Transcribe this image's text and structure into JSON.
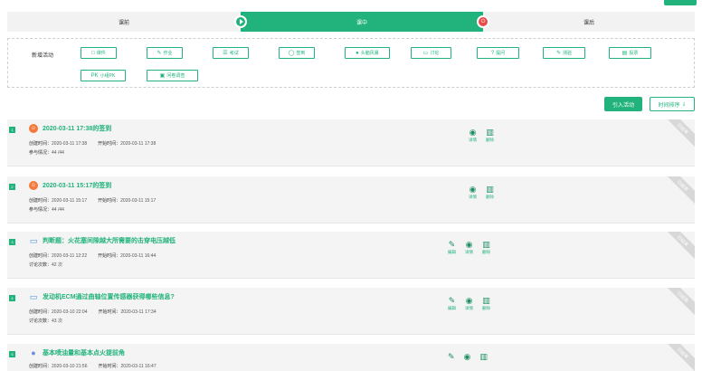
{
  "stages": {
    "before": "课前",
    "during": "课中",
    "after": "课后",
    "stop_icon": "power-icon"
  },
  "activities": {
    "title": "新增活动",
    "buttons": [
      {
        "name": "courseware",
        "label": "课件",
        "icon": "□"
      },
      {
        "name": "homework",
        "label": "作业",
        "icon": "✎"
      },
      {
        "name": "exam",
        "label": "考试",
        "icon": "☰"
      },
      {
        "name": "sign-in",
        "label": "签到",
        "icon": "◯"
      },
      {
        "name": "brainstorm",
        "label": "头脑风暴",
        "icon": "●"
      },
      {
        "name": "discussion",
        "label": "讨论",
        "icon": "▭"
      },
      {
        "name": "question",
        "label": "提问",
        "icon": "?"
      },
      {
        "name": "quiz",
        "label": "测验",
        "icon": "✎"
      },
      {
        "name": "vote",
        "label": "投票",
        "icon": "▤"
      },
      {
        "name": "pk",
        "label": "小组PK",
        "icon": "PK"
      },
      {
        "name": "survey",
        "label": "问卷调查",
        "icon": "▣"
      }
    ]
  },
  "toolbar": {
    "import_label": "引入活动",
    "sort_label": "时间排序",
    "sort_icon": "⇃"
  },
  "labels": {
    "created": "创建时间：",
    "started": "开始时间：",
    "participation": "参与情况：",
    "discussion_count": "讨论次数：",
    "ribbon": "已结束",
    "edit": "编辑",
    "detail": "详情",
    "delete": "删除"
  },
  "cards": [
    {
      "num": "1",
      "title": "2020-03-11 17:38的签到",
      "created": "2020-03-11 17:38",
      "started": "2020-03-11 17:38",
      "extra": "44 /44"
    },
    {
      "num": "2",
      "title": "2020-03-11 15:17的签到",
      "created": "2020-03-11 15:17",
      "started": "2020-03-11 15:17",
      "extra": "44 /44"
    },
    {
      "num": "3",
      "title": "判断题：火花塞间隙越大所需要的击穿电压越低",
      "created": "2020-03-11 12:22",
      "started": "2020-03-11 16:44",
      "extra": "42 次"
    },
    {
      "num": "4",
      "title": "发动机ECM通过曲轴位置传感器获得哪些信息?",
      "created": "2020-03-10 22:04",
      "started": "2020-03-11 17:34",
      "extra": "43 次"
    },
    {
      "num": "5",
      "title": "基本喷油量和基本点火提前角",
      "created": "2020-03-10 21:56",
      "started": "2020-03-11 16:47"
    }
  ]
}
